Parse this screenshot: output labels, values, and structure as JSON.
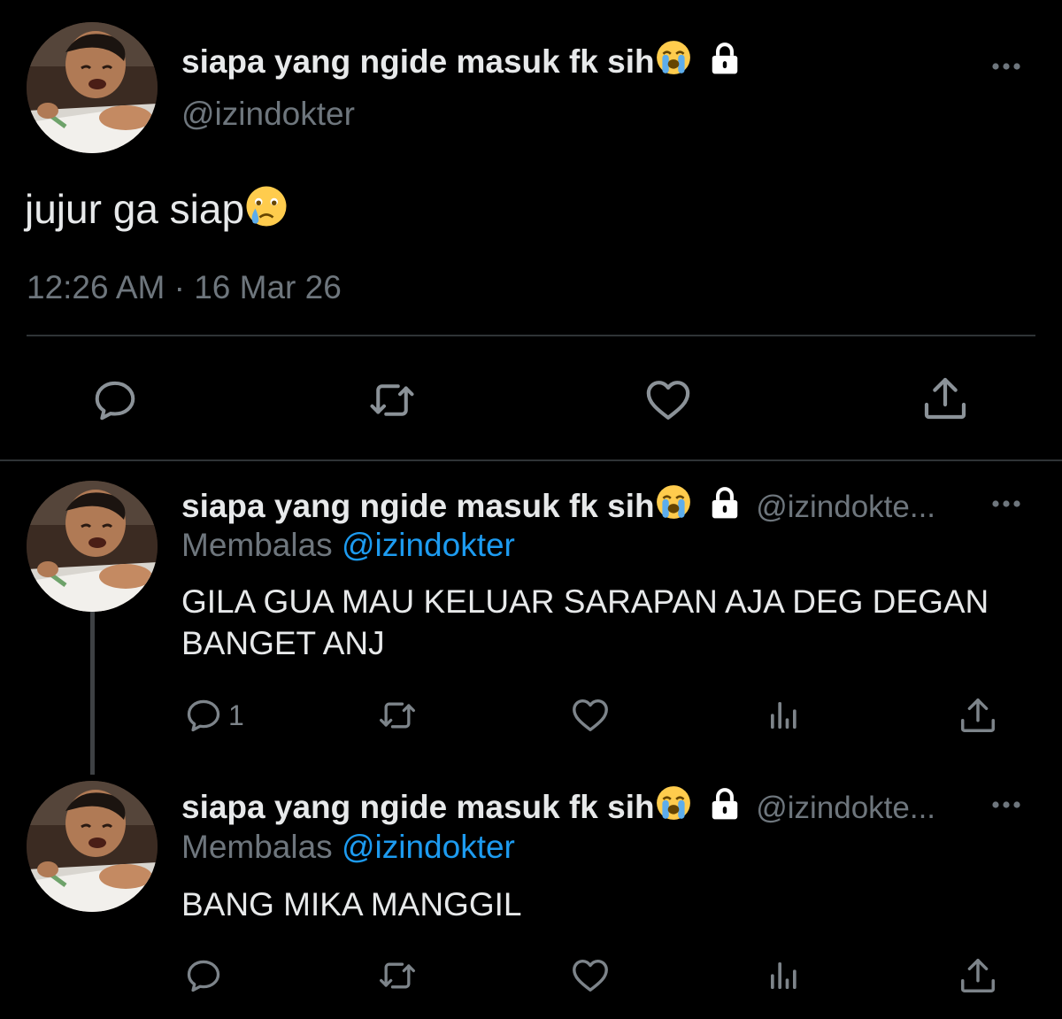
{
  "main_tweet": {
    "display_name": "siapa yang ngide masuk fk sih",
    "handle": "@izindokter",
    "text": "jujur ga siap",
    "timestamp": "12:26 AM · 16 Mar 26"
  },
  "replies": [
    {
      "display_name": "siapa yang ngide masuk fk sih",
      "handle": "@izindokte...",
      "replying_prefix": "Membalas",
      "replying_to": "@izindokter",
      "text_lines": [
        "GILA GUA MAU KELUAR SARAPAN AJA DEG DEGAN",
        "BANGET ANJ"
      ],
      "reply_count": "1"
    },
    {
      "display_name": "siapa yang ngide masuk fk sih",
      "handle": "@izindokte...",
      "replying_prefix": "Membalas",
      "replying_to": "@izindokter",
      "text_lines": [
        "BANG MIKA MANGGIL"
      ],
      "reply_count": ""
    }
  ],
  "colors": {
    "background": "#000000",
    "text": "#e7e9ea",
    "muted": "#6e767d",
    "link": "#1d9bf0",
    "divider": "#2f3336"
  },
  "icons": {
    "name_emoji": "loudly-crying-face-emoji",
    "text_emoji": "face-holding-back-tears-emoji",
    "protected": "lock-icon",
    "actions": [
      "reply-icon",
      "retweet-icon",
      "like-icon",
      "analytics-icon",
      "share-icon"
    ]
  }
}
